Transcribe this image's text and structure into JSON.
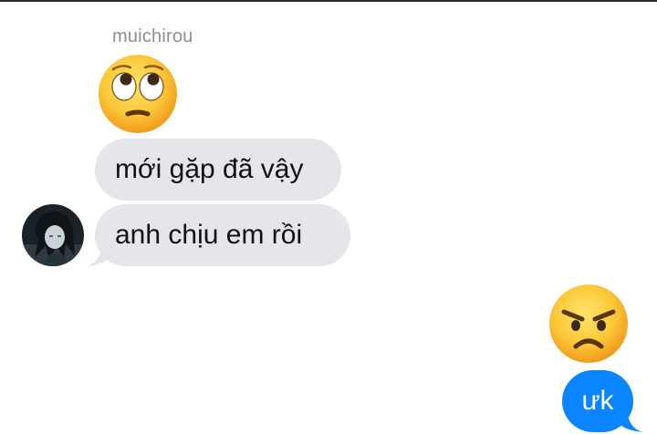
{
  "conversation": {
    "sender_name": "muichirou",
    "messages": [
      {
        "direction": "incoming",
        "type": "emoji",
        "icon": "face-with-rolling-eyes-icon"
      },
      {
        "direction": "incoming",
        "type": "text",
        "text": "mới gặp đã vậy"
      },
      {
        "direction": "incoming",
        "type": "text",
        "text": "anh chịu em rồi"
      },
      {
        "direction": "outgoing",
        "type": "emoji",
        "icon": "angry-face-icon"
      },
      {
        "direction": "outgoing",
        "type": "text",
        "text": "ưk"
      }
    ]
  },
  "colors": {
    "incoming_bubble": "#e5e5ea",
    "outgoing_bubble": "#0b84ff",
    "sender_name": "#8e8e93"
  }
}
